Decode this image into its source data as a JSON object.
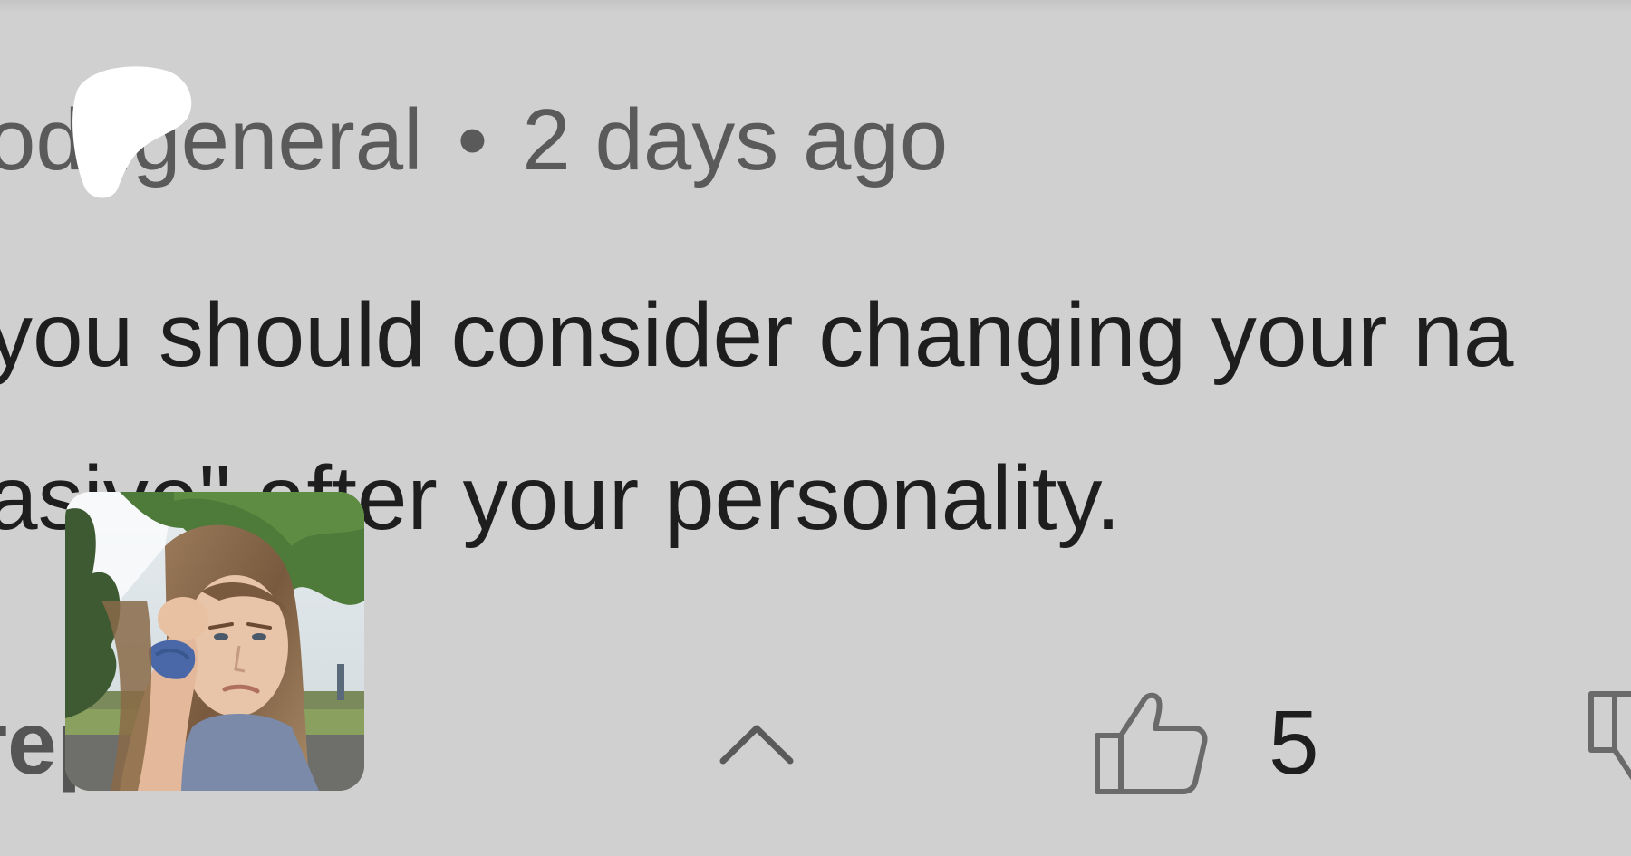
{
  "comment": {
    "author_partial": "odugeneral",
    "separator": "•",
    "timestamp": "2 days ago",
    "text_line1": " you should consider changing your na",
    "text_line2": "asive\" after your personality.",
    "replies_label": "replies",
    "likes": "5"
  },
  "icons": {
    "replies_toggle": "chevron-up-icon",
    "like": "thumbs-up-icon",
    "dislike": "thumbs-down-icon"
  },
  "colors": {
    "background": "#d0d0d0",
    "text_primary": "#1e1e1e",
    "text_secondary": "#5a5a5a"
  }
}
